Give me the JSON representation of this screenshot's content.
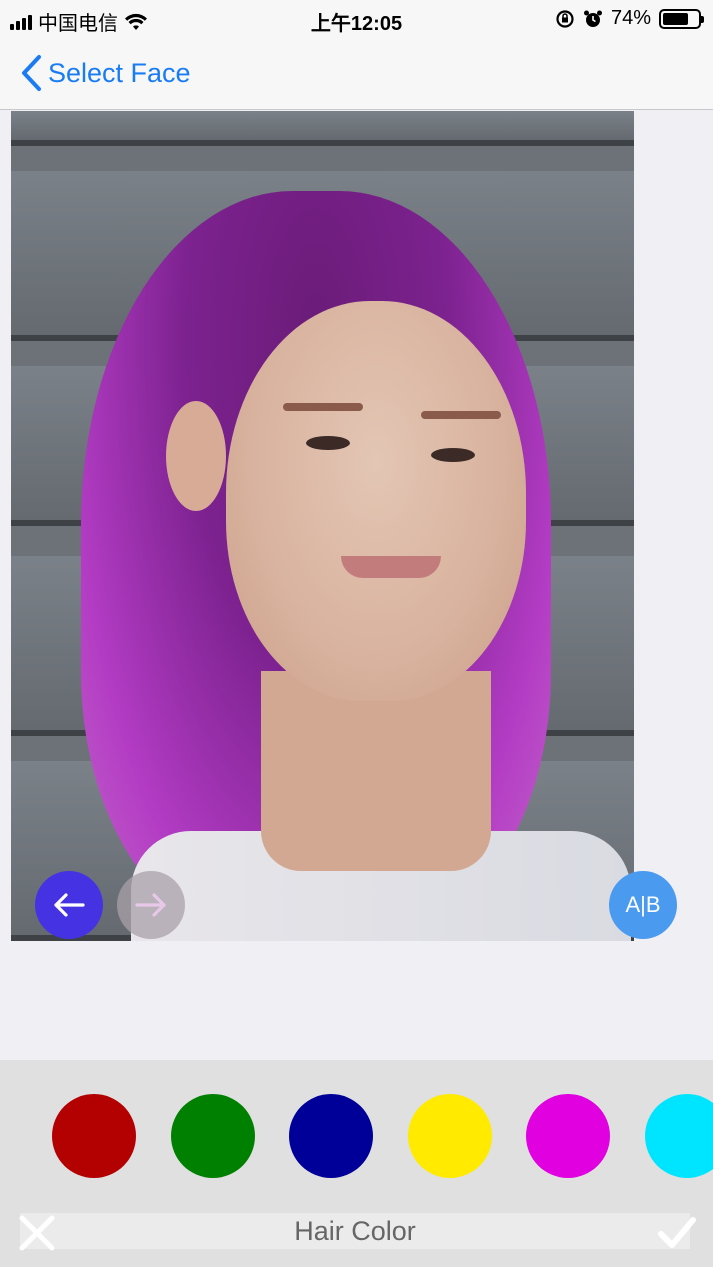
{
  "status": {
    "carrier": "中国电信",
    "time": "上午12:05",
    "battery": "74%",
    "battery_level": 0.74
  },
  "nav": {
    "back_label": "Select Face"
  },
  "photo_controls": {
    "ab_label": "A|B"
  },
  "colors": {
    "swatches": [
      "#b30000",
      "#008000",
      "#000099",
      "#ffea00",
      "#e000e0",
      "#00e5ff"
    ],
    "accent": "#1a7cf5"
  },
  "bottom": {
    "label": "Hair Color"
  }
}
